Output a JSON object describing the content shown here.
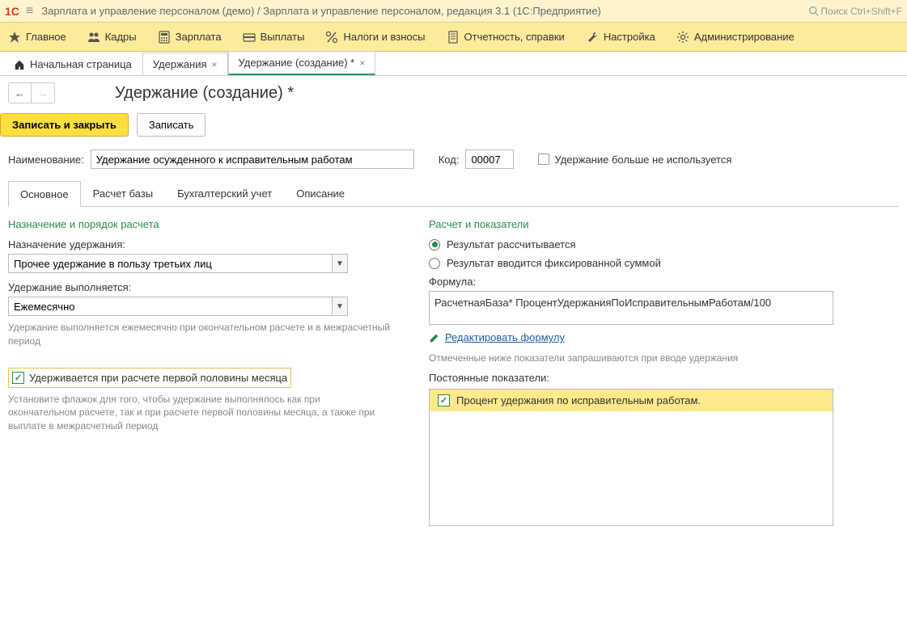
{
  "titlebar": {
    "logo": "1С",
    "title": "Зарплата и управление персоналом (демо) / Зарплата и управление персоналом, редакция 3.1  (1С:Предприятие)",
    "search_placeholder": "Поиск Ctrl+Shift+F"
  },
  "menubar": {
    "items": [
      {
        "icon": "star",
        "label": "Главное"
      },
      {
        "icon": "people",
        "label": "Кадры"
      },
      {
        "icon": "calc",
        "label": "Зарплата"
      },
      {
        "icon": "wallet",
        "label": "Выплаты"
      },
      {
        "icon": "percent",
        "label": "Налоги и взносы"
      },
      {
        "icon": "report",
        "label": "Отчетность, справки"
      },
      {
        "icon": "wrench",
        "label": "Настройка"
      },
      {
        "icon": "gear",
        "label": "Администрирование"
      }
    ]
  },
  "tabs": {
    "home": "Начальная страница",
    "items": [
      {
        "label": "Удержания",
        "active": false
      },
      {
        "label": "Удержание (создание) *",
        "active": true
      }
    ]
  },
  "page": {
    "title": "Удержание (создание) *",
    "save_close": "Записать и закрыть",
    "save": "Записать"
  },
  "header_fields": {
    "name_label": "Наименование:",
    "name_value": "Удержание осужденного к исправительным работам",
    "code_label": "Код:",
    "code_value": "00007",
    "not_used_label": "Удержание больше не используется"
  },
  "inner_tabs": [
    "Основное",
    "Расчет базы",
    "Бухгалтерский учет",
    "Описание"
  ],
  "left": {
    "section": "Назначение и порядок расчета",
    "purpose_label": "Назначение удержания:",
    "purpose_value": "Прочее удержание в пользу третьих лиц",
    "performed_label": "Удержание выполняется:",
    "performed_value": "Ежемесячно",
    "performed_hint": "Удержание выполняется ежемесячно при окончательном расчете и в межрасчетный период",
    "first_half_label": "Удерживается при расчете первой половины месяца",
    "first_half_hint": "Установите флажок для того, чтобы удержание выполнялось как при окончательном расчете, так и при расчете первой половины месяца, а также при выплате в межрасчетный период"
  },
  "right": {
    "section": "Расчет и показатели",
    "radio1": "Результат рассчитывается",
    "radio2": "Результат вводится фиксированной суммой",
    "formula_label": "Формула:",
    "formula_value": "РасчетнаяБаза* ПроцентУдержанияПоИсправительнымРаботам/100",
    "edit_formula": "Редактировать формулу",
    "indicators_hint": "Отмеченные ниже показатели запрашиваются при вводе удержания",
    "indicators_label": "Постоянные показатели:",
    "indicator1": "Процент удержания по исправительным работам."
  }
}
